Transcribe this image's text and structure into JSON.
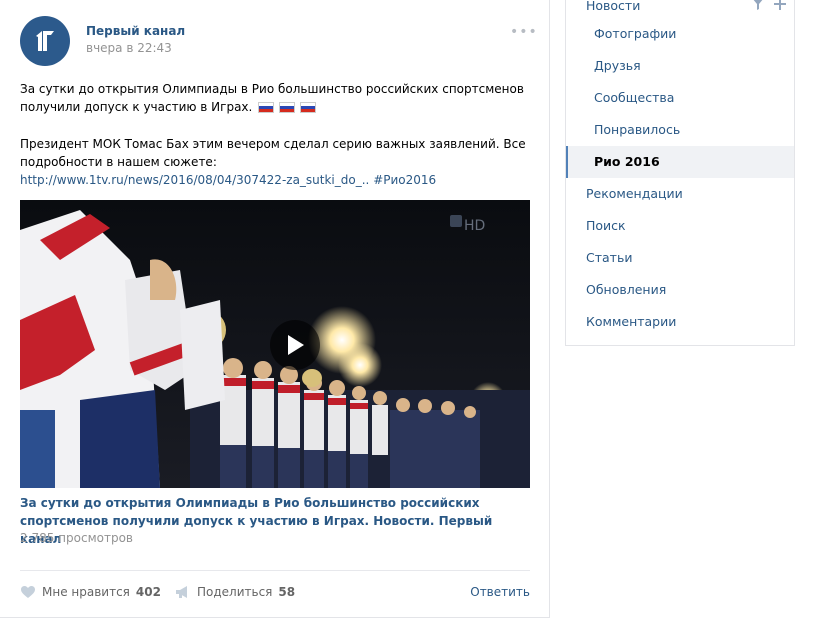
{
  "post": {
    "author": "Первый канал",
    "time": "вчера в 22:43",
    "more_icon": "more-dots-icon",
    "text_line1": "За сутки до открытия Олимпиады в Рио большинство российских спортсменов",
    "text_line2": "получили допуск к участию в Играх.",
    "text_line3": "Президент МОК Томас Бах этим вечером сделал серию важных заявлений. Все",
    "text_line4": "подробности в нашем сюжете:",
    "link": "http://www.1tv.ru/news/2016/08/04/307422-za_sutki_do_..",
    "hashtag": "#Рио2016",
    "video": {
      "watermark": "HD",
      "title": "За сутки до открытия Олимпиады в Рио большинство российских спортсменов получили допуск к участию в Играх. Новости. Первый канал",
      "views": "2 785 просмотров"
    },
    "actions": {
      "like_label": "Мне нравится",
      "like_count": "402",
      "share_label": "Поделиться",
      "share_count": "58",
      "reply_label": "Ответить"
    }
  },
  "sidebar": {
    "items": [
      {
        "label": "Новости"
      },
      {
        "label": "Фотографии"
      },
      {
        "label": "Друзья"
      },
      {
        "label": "Сообщества"
      },
      {
        "label": "Понравилось"
      },
      {
        "label": "Рио 2016"
      },
      {
        "label": "Рекомендации"
      },
      {
        "label": "Поиск"
      },
      {
        "label": "Статьи"
      },
      {
        "label": "Обновления"
      },
      {
        "label": "Комментарии"
      }
    ],
    "filter_icon": "filter-icon",
    "add_icon": "plus-icon"
  },
  "colors": {
    "link": "#2a5885",
    "muted": "#939393",
    "accent": "#5181b8"
  }
}
